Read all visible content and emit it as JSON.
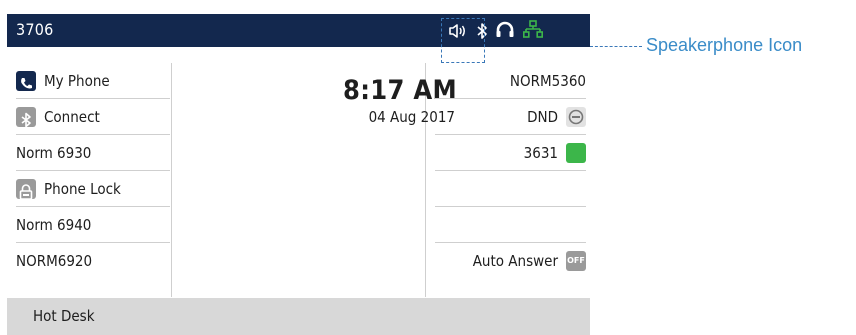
{
  "statusbar": {
    "extension": "3706",
    "icons": [
      "speaker-icon",
      "bluetooth-icon",
      "headset-icon",
      "network-icon"
    ]
  },
  "left_keys": [
    {
      "label": "My Phone",
      "icon": "phone-icon",
      "icon_color": "#13284e"
    },
    {
      "label": "Connect",
      "icon": "bluetooth-icon",
      "icon_color": "#9a9a9a"
    },
    {
      "label": "Norm 6930",
      "icon": null
    },
    {
      "label": "Phone Lock",
      "icon": "lock-icon",
      "icon_color": "#9a9a9a"
    },
    {
      "label": "Norm 6940",
      "icon": null
    },
    {
      "label": "NORM6920",
      "icon": null
    }
  ],
  "center": {
    "time": "8:17 AM",
    "date": "04 Aug 2017",
    "pages": 2,
    "active_page": 1
  },
  "right_keys": [
    {
      "label": "NORM5360",
      "icon": null
    },
    {
      "label": "DND",
      "icon": "minus-circle-icon"
    },
    {
      "label": "3631",
      "icon": "presence-icon",
      "icon_color": "#3cb64a"
    },
    {
      "label": "",
      "icon": null
    },
    {
      "label": "",
      "icon": null
    },
    {
      "label": "Auto Answer",
      "icon": "off-toggle-icon",
      "toggle_text": "OFF"
    }
  ],
  "softkeys": {
    "bottom_label": "Hot Desk"
  },
  "callout": {
    "text": "Speakerphone Icon"
  },
  "colors": {
    "statusbar_bg": "#13284e",
    "callout": "#3a8cc8",
    "network_icon": "#3cb64a"
  }
}
